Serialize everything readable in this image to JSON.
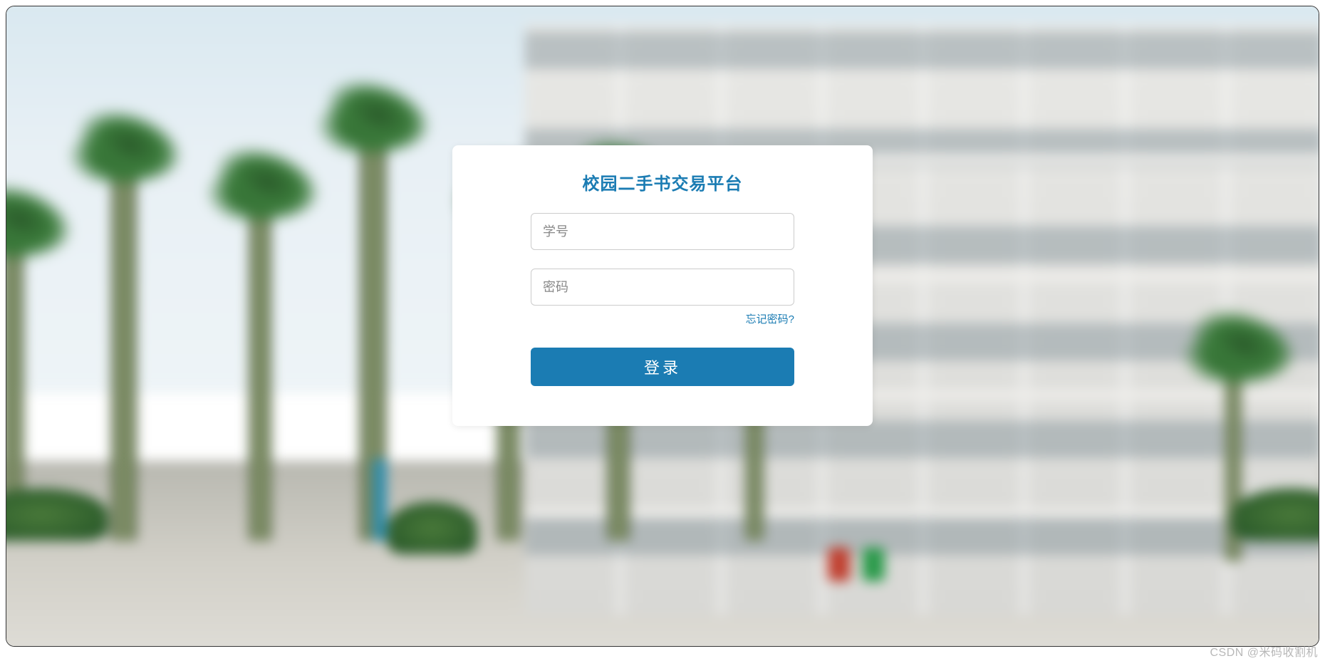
{
  "login": {
    "title": "校园二手书交易平台",
    "student_id_placeholder": "学号",
    "password_placeholder": "密码",
    "forgot_password": "忘记密码?",
    "submit_label": "登录"
  },
  "watermark": "CSDN @米码收割机"
}
